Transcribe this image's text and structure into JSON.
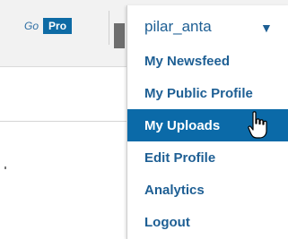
{
  "header": {
    "go_label": "Go",
    "pro_label": "Pro"
  },
  "user_menu": {
    "username": "pilar_anta",
    "caret": "▼",
    "items": [
      {
        "label": "My Newsfeed"
      },
      {
        "label": "My Public Profile"
      },
      {
        "label": "My Uploads",
        "active": true
      },
      {
        "label": "Edit Profile"
      },
      {
        "label": "Analytics"
      },
      {
        "label": "Logout"
      }
    ],
    "hovered_item": "My Uploads",
    "cursor_icon": "hand-pointer-icon"
  },
  "colors": {
    "link_blue": "#1e5f94",
    "highlight_blue": "#0b6aa8",
    "pro_badge": "#0e6ba5",
    "topbar_bg": "#f2f2f2"
  }
}
